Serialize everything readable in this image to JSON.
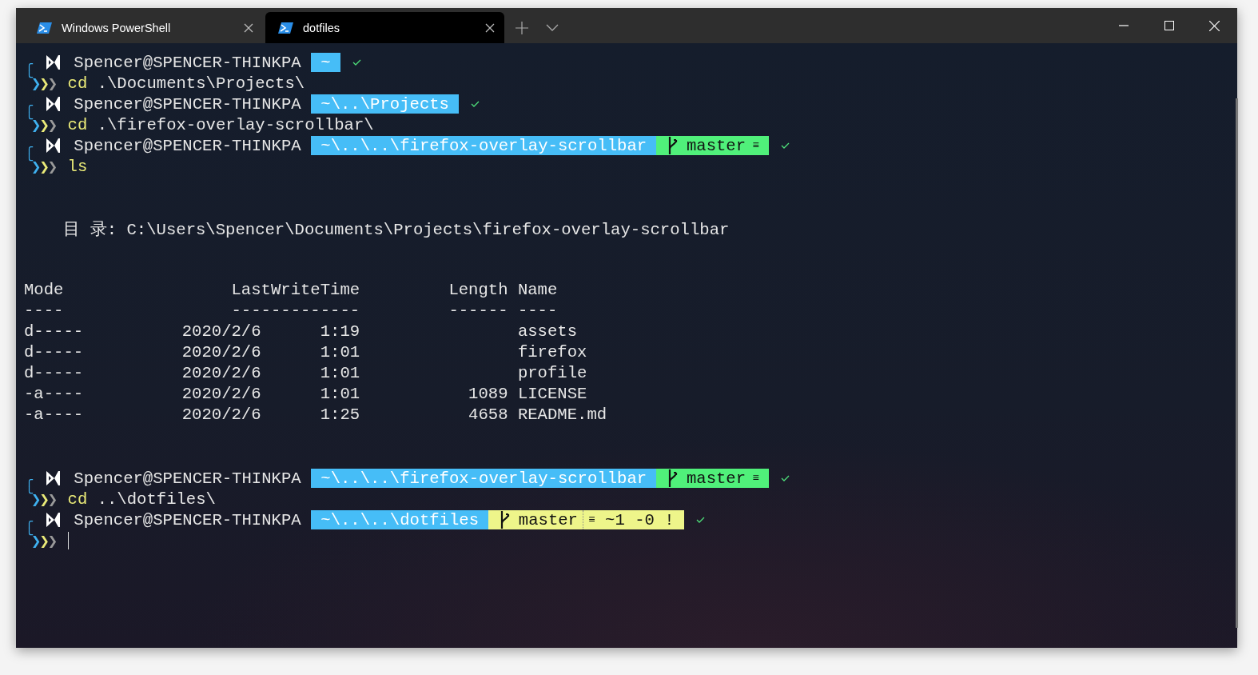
{
  "tabs": [
    {
      "title": "Windows PowerShell",
      "selected": false
    },
    {
      "title": "dotfiles",
      "selected": true
    }
  ],
  "lines": [
    {
      "kind": "prompt",
      "corner": "╭",
      "user": "Spencer@SPENCER-THINKPA",
      "segments": [
        {
          "kind": "path",
          "text": "~",
          "color": "#46bdf7"
        }
      ]
    },
    {
      "kind": "command",
      "corner": "╰",
      "arrows": "❯❯❯",
      "command": "cd",
      "args": ".\\Documents\\Projects\\"
    },
    {
      "kind": "prompt",
      "corner": "╭",
      "user": "Spencer@SPENCER-THINKPA",
      "segments": [
        {
          "kind": "path",
          "text": "~\\..\\Projects",
          "color": "#46bdf7"
        }
      ]
    },
    {
      "kind": "command",
      "corner": "╰",
      "arrows": "❯❯❯",
      "command": "cd",
      "args": ".\\firefox-overlay-scrollbar\\"
    },
    {
      "kind": "prompt",
      "corner": "╭",
      "user": "Spencer@SPENCER-THINKPA",
      "segments": [
        {
          "kind": "path",
          "text": "~\\..\\..\\firefox-overlay-scrollbar",
          "color": "#46bdf7"
        },
        {
          "kind": "git",
          "branch": "master",
          "upstream": "≡",
          "color": "#50f07a"
        }
      ]
    },
    {
      "kind": "command",
      "corner": "╰",
      "arrows": "❯❯❯",
      "command": "ls"
    },
    {
      "kind": "blank"
    },
    {
      "kind": "blank"
    },
    {
      "kind": "output",
      "text": "目 录: C:\\Users\\Spencer\\Documents\\Projects\\firefox-overlay-scrollbar"
    },
    {
      "kind": "blank"
    },
    {
      "kind": "blank"
    },
    {
      "kind": "table",
      "header": [
        "Mode",
        "LastWriteTime",
        "Length",
        "Name"
      ],
      "rule": [
        "----",
        "-------------",
        "------",
        "----"
      ],
      "rows": [
        {
          "mode": "d-----",
          "date": "2020/2/6",
          "time": "1:19",
          "name": "assets"
        },
        {
          "mode": "d-----",
          "date": "2020/2/6",
          "time": "1:01",
          "name": "firefox"
        },
        {
          "mode": "d-----",
          "date": "2020/2/6",
          "time": "1:01",
          "name": "profile"
        },
        {
          "mode": "-a----",
          "date": "2020/2/6",
          "time": "1:01",
          "length": "1089",
          "name": "LICENSE"
        },
        {
          "mode": "-a----",
          "date": "2020/2/6",
          "time": "1:25",
          "length": "4658",
          "name": "README.md"
        }
      ]
    },
    {
      "kind": "blank"
    },
    {
      "kind": "blank"
    },
    {
      "kind": "prompt",
      "corner": "╭",
      "user": "Spencer@SPENCER-THINKPA",
      "segments": [
        {
          "kind": "path",
          "text": "~\\..\\..\\firefox-overlay-scrollbar",
          "color": "#46bdf7"
        },
        {
          "kind": "git",
          "branch": "master",
          "upstream": "≡",
          "color": "#50f07a"
        }
      ]
    },
    {
      "kind": "command",
      "corner": "╰",
      "arrows": "❯❯❯",
      "command": "cd",
      "args": "..\\dotfiles\\"
    },
    {
      "kind": "prompt",
      "corner": "╭",
      "user": "Spencer@SPENCER-THINKPA",
      "segments": [
        {
          "kind": "path",
          "text": "~\\..\\..\\dotfiles",
          "color": "#46bdf7"
        },
        {
          "kind": "git",
          "branch": "master",
          "upstream": "≡",
          "status": "~1 -0 !",
          "color": "#eef58a"
        }
      ]
    },
    {
      "kind": "input",
      "corner": "╰",
      "arrows": "❯❯❯"
    }
  ]
}
